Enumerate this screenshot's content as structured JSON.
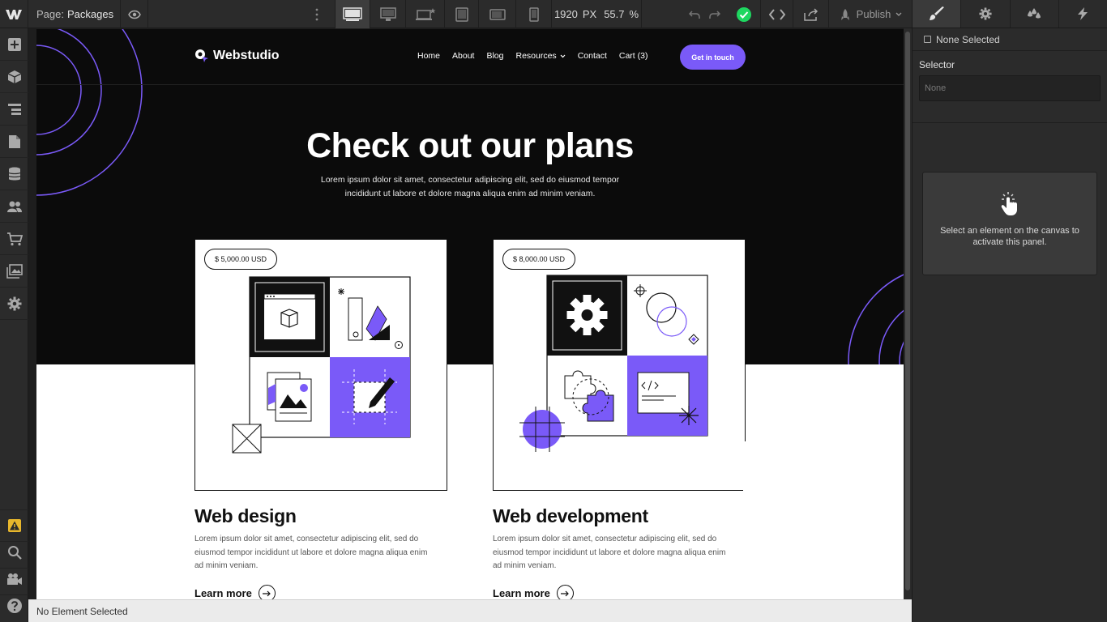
{
  "toolbar": {
    "page_prefix": "Page:",
    "page_name": "Packages",
    "width_px": "1920",
    "width_unit": "PX",
    "zoom": "55.7",
    "zoom_unit": "%",
    "publish_label": "Publish"
  },
  "right_panel": {
    "none_selected": "None Selected",
    "selector_title": "Selector",
    "selector_placeholder": "None",
    "empty_message": "Select an element on the canvas to activate this panel."
  },
  "status_bar": {
    "text": "No Element Selected"
  },
  "site": {
    "brand": "Webstudio",
    "nav": [
      "Home",
      "About",
      "Blog",
      "Resources",
      "Contact",
      "Cart (3)"
    ],
    "cta": "Get in touch",
    "hero_title": "Check out our plans",
    "hero_subtitle": "Lorem ipsum dolor sit amet, consectetur adipiscing elit, sed do eiusmod tempor incididunt ut labore et dolore magna aliqua enim ad minim veniam.",
    "plans": [
      {
        "price": "$ 5,000.00 USD",
        "title": "Web design",
        "description": "Lorem ipsum dolor sit amet, consectetur adipiscing elit, sed do eiusmod tempor incididunt ut labore et dolore magna aliqua enim ad minim veniam.",
        "link": "Learn more"
      },
      {
        "price": "$ 8,000.00 USD",
        "title": "Web development",
        "description": "Lorem ipsum dolor sit amet, consectetur adipiscing elit, sed do eiusmod tempor incididunt ut labore et dolore magna aliqua enim ad minim veniam.",
        "link": "Learn more"
      }
    ]
  },
  "colors": {
    "accent": "#7a5af8",
    "editor_bg": "#2b2b2b",
    "success": "#1ed760"
  },
  "icons": {
    "left_sidebar": [
      "add-icon",
      "components-icon",
      "navigator-icon",
      "pages-icon",
      "cms-icon",
      "users-icon",
      "ecommerce-icon",
      "assets-icon",
      "settings-icon",
      "audit-icon",
      "search-icon",
      "video-icon",
      "help-icon"
    ],
    "right_tabs": [
      "style-brush-icon",
      "element-settings-icon",
      "style-manager-icon",
      "interactions-icon"
    ]
  }
}
